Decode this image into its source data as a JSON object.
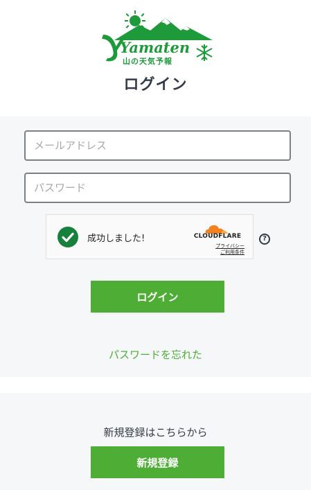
{
  "brand": {
    "logo_text": "Yamaten",
    "logo_subtitle": "山の天気予報"
  },
  "page": {
    "title": "ログイン"
  },
  "form": {
    "email_placeholder": "メールアドレス",
    "email_value": "",
    "password_placeholder": "パスワード",
    "password_value": "",
    "login_label": "ログイン",
    "forgot_label": "パスワードを忘れた"
  },
  "turnstile": {
    "status": "成功しました!",
    "provider": "CLOUDFLARE",
    "privacy_label": "プライバシー",
    "terms_label": "ご利用条件",
    "help_label": "?",
    "accent_color": "#f48120",
    "success_color": "#16803c"
  },
  "register": {
    "prompt": "新規登録はこちらから",
    "button_label": "新規登録"
  },
  "colors": {
    "brand_green": "#4dad35",
    "logo_green": "#1f9a3b",
    "panel_bg": "#f6f7f9"
  }
}
